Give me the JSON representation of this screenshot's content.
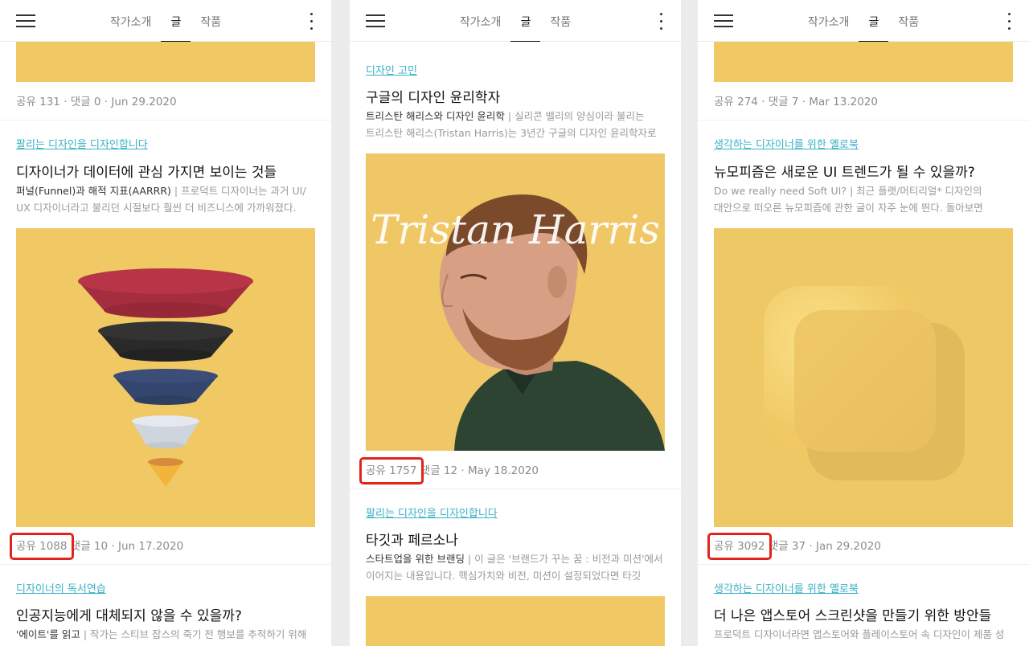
{
  "header": {
    "tabs": [
      "작가소개",
      "글",
      "작품"
    ],
    "active_tab": "글"
  },
  "panels": [
    {
      "top_meta": {
        "share": "공유 131",
        "rest": " · 댓글 0 · Jun 29.2020"
      },
      "post": {
        "category": "팔리는 디자인을 디자인합니다",
        "title": "디자이너가 데이터에 관심 가지면 보이는 것들",
        "desc_bold": "퍼널(Funnel)과 해적 지표(AARRR)",
        "desc_rest": " | 프로덕트 디자이너는 과거 UI/ UX 디자이너라고 불리던 시절보다 훨씬 더 비즈니스에 가까워졌다.",
        "image": "funnel-illustration",
        "share": "공유 1088",
        "rest": " 댓글 10 · Jun 17.2020"
      },
      "next": {
        "category": "디자이너의 독서연습",
        "title": "인공지능에게 대체되지 않을 수 있을까?",
        "desc_bold": "'에이트'를 읽고",
        "desc_rest": " | 작가는 스티브 잡스의 죽기 전 행보를 추적하기 위해"
      }
    },
    {
      "post": {
        "category": "디자인 고민",
        "title": "구글의 디자인 윤리학자",
        "desc_bold": "트리스탄 해리스와 디자인 윤리학",
        "desc_rest": " | 실리콘 밸리의 양심이라 불리는 트리스탄 해리스(Tristan Harris)는 3년간 구글의 디자인 윤리학자로 일",
        "image_text": "Tristan Harris",
        "share": "공유 1757",
        "rest": " 댓글 12 · May 18.2020"
      },
      "next": {
        "category": "팔리는 디자인을 디자인합니다",
        "title": "타깃과 페르소나",
        "desc_bold": "스타트업을 위한 브랜딩",
        "desc_rest": " | 이 글은 '브랜드가 꾸는 꿈 : 비전과 미션'에서 이어지는 내용입니다. 핵심가치와 비전, 미션이 설정되었다면 타깃"
      }
    },
    {
      "top_meta": {
        "share": "공유 274",
        "rest": " · 댓글 7 · Mar 13.2020"
      },
      "post": {
        "category": "생각하는 디자이너를 위한 옐로북",
        "title": "뉴모피즘은 새로운 UI 트렌드가 될 수 있을까?",
        "desc_bold": "",
        "desc_rest": "Do we really need Soft UI? | 최근 플랫/머티리얼* 디자인의 대안으로 떠오른 뉴모피즘에 관한 글이 자주 눈에 띈다. 돌아보면 모바일",
        "image": "neumorphism-button",
        "share": "공유 3092",
        "rest": " 댓글 37 · Jan 29.2020"
      },
      "next": {
        "category": "생각하는 디자이너를 위한 옐로북",
        "title": "더 나은 앱스토어 스크린샷을 만들기 위한 방안들",
        "desc_bold": "",
        "desc_rest": "프로덕트 디자이너라면 앱스토어와 플레이스토어 속 디자인이 제품 성"
      }
    }
  ],
  "colors": {
    "accent_link": "#37b1c6",
    "thumb_yellow": "#f0c864",
    "highlight_box": "#e0241c"
  }
}
